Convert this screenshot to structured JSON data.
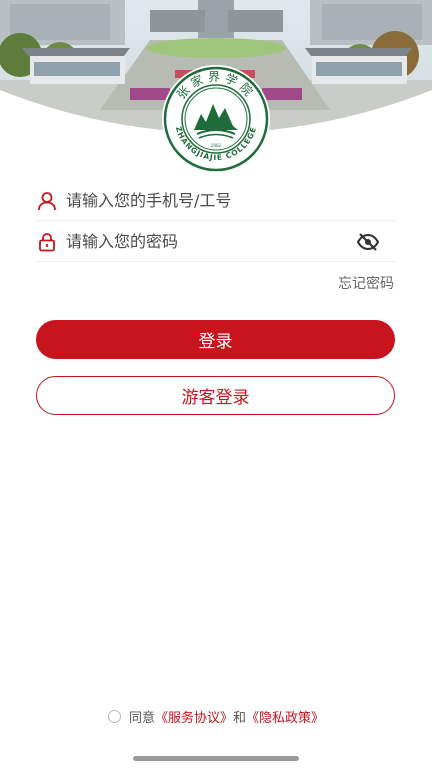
{
  "login": {
    "phone_placeholder": "请输入您的手机号/工号",
    "password_placeholder": "请输入您的密码",
    "forgot_label": "忘记密码",
    "login_label": "登录",
    "guest_label": "游客登录"
  },
  "agreement": {
    "prefix": "同意",
    "service_link": "《服务协议》",
    "conjunction": "和",
    "privacy_link": "《隐私政策》"
  },
  "logo": {
    "cn_name": "张家界学院",
    "en_name": "ZHANGJIAJIE COLLEGE",
    "year": "2002"
  },
  "colors": {
    "accent": "#c8141d",
    "logo_green": "#1f6b3a"
  },
  "icons": {
    "phone_field": "user-icon",
    "password_field": "lock-icon",
    "toggle": "eye-off-icon"
  }
}
